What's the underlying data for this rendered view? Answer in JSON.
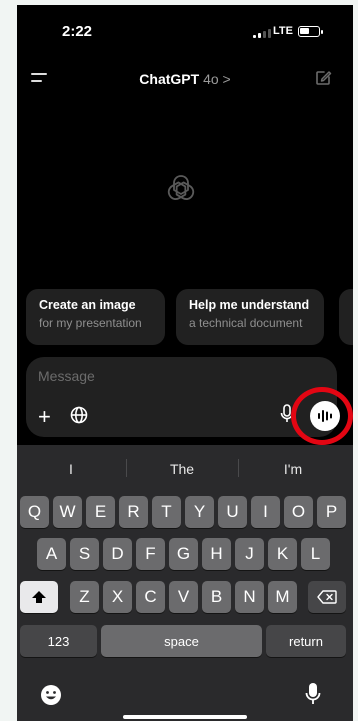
{
  "status_bar": {
    "time": "2:22",
    "network": "LTE"
  },
  "header": {
    "title": "ChatGPT",
    "model": "4o",
    "chevron": ">"
  },
  "suggestions": [
    {
      "title": "Create an image",
      "subtitle": "for my presentation"
    },
    {
      "title": "Help me understand",
      "subtitle": "a technical document"
    }
  ],
  "composer": {
    "placeholder": "Message",
    "value": ""
  },
  "keyboard": {
    "predictions": [
      "I",
      "The",
      "I'm"
    ],
    "row1": [
      "Q",
      "W",
      "E",
      "R",
      "T",
      "Y",
      "U",
      "I",
      "O",
      "P"
    ],
    "row2": [
      "A",
      "S",
      "D",
      "F",
      "G",
      "H",
      "J",
      "K",
      "L"
    ],
    "row3": [
      "Z",
      "X",
      "C",
      "V",
      "B",
      "N",
      "M"
    ],
    "numbers_label": "123",
    "space_label": "space",
    "return_label": "return"
  },
  "icons": [
    "menu-icon",
    "new-chat-icon",
    "openai-logo-icon",
    "plus-icon",
    "globe-icon",
    "microphone-icon",
    "voice-mode-icon",
    "shift-icon",
    "backspace-icon",
    "emoji-icon",
    "dictation-icon"
  ],
  "colors": {
    "background": "#000000",
    "card": "#212121",
    "highlight_ring": "#e30613",
    "keyboard": "#2a2a2c"
  }
}
